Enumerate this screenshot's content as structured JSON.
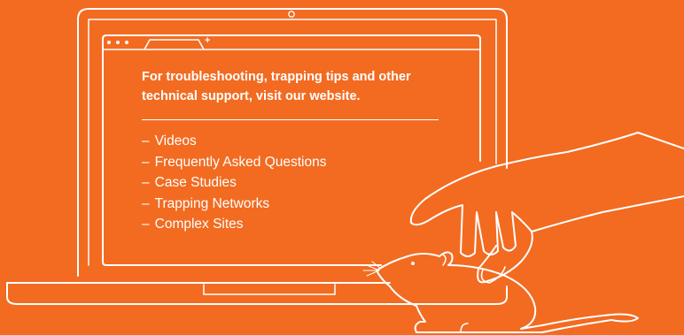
{
  "message": {
    "intro_line1": "For troubleshooting, trapping tips and other",
    "intro_line2": "technical support, visit our website."
  },
  "links": [
    {
      "label": "Videos"
    },
    {
      "label": "Frequently Asked Questions"
    },
    {
      "label": "Case Studies"
    },
    {
      "label": "Trapping Networks"
    },
    {
      "label": "Complex Sites"
    }
  ],
  "bullet": "–",
  "browser": {
    "new_tab_symbol": "+"
  },
  "colors": {
    "background": "#f26b21",
    "line": "#ffffff"
  },
  "illustration": {
    "subjects": [
      "laptop-icon",
      "hand-icon",
      "rat-icon"
    ]
  }
}
